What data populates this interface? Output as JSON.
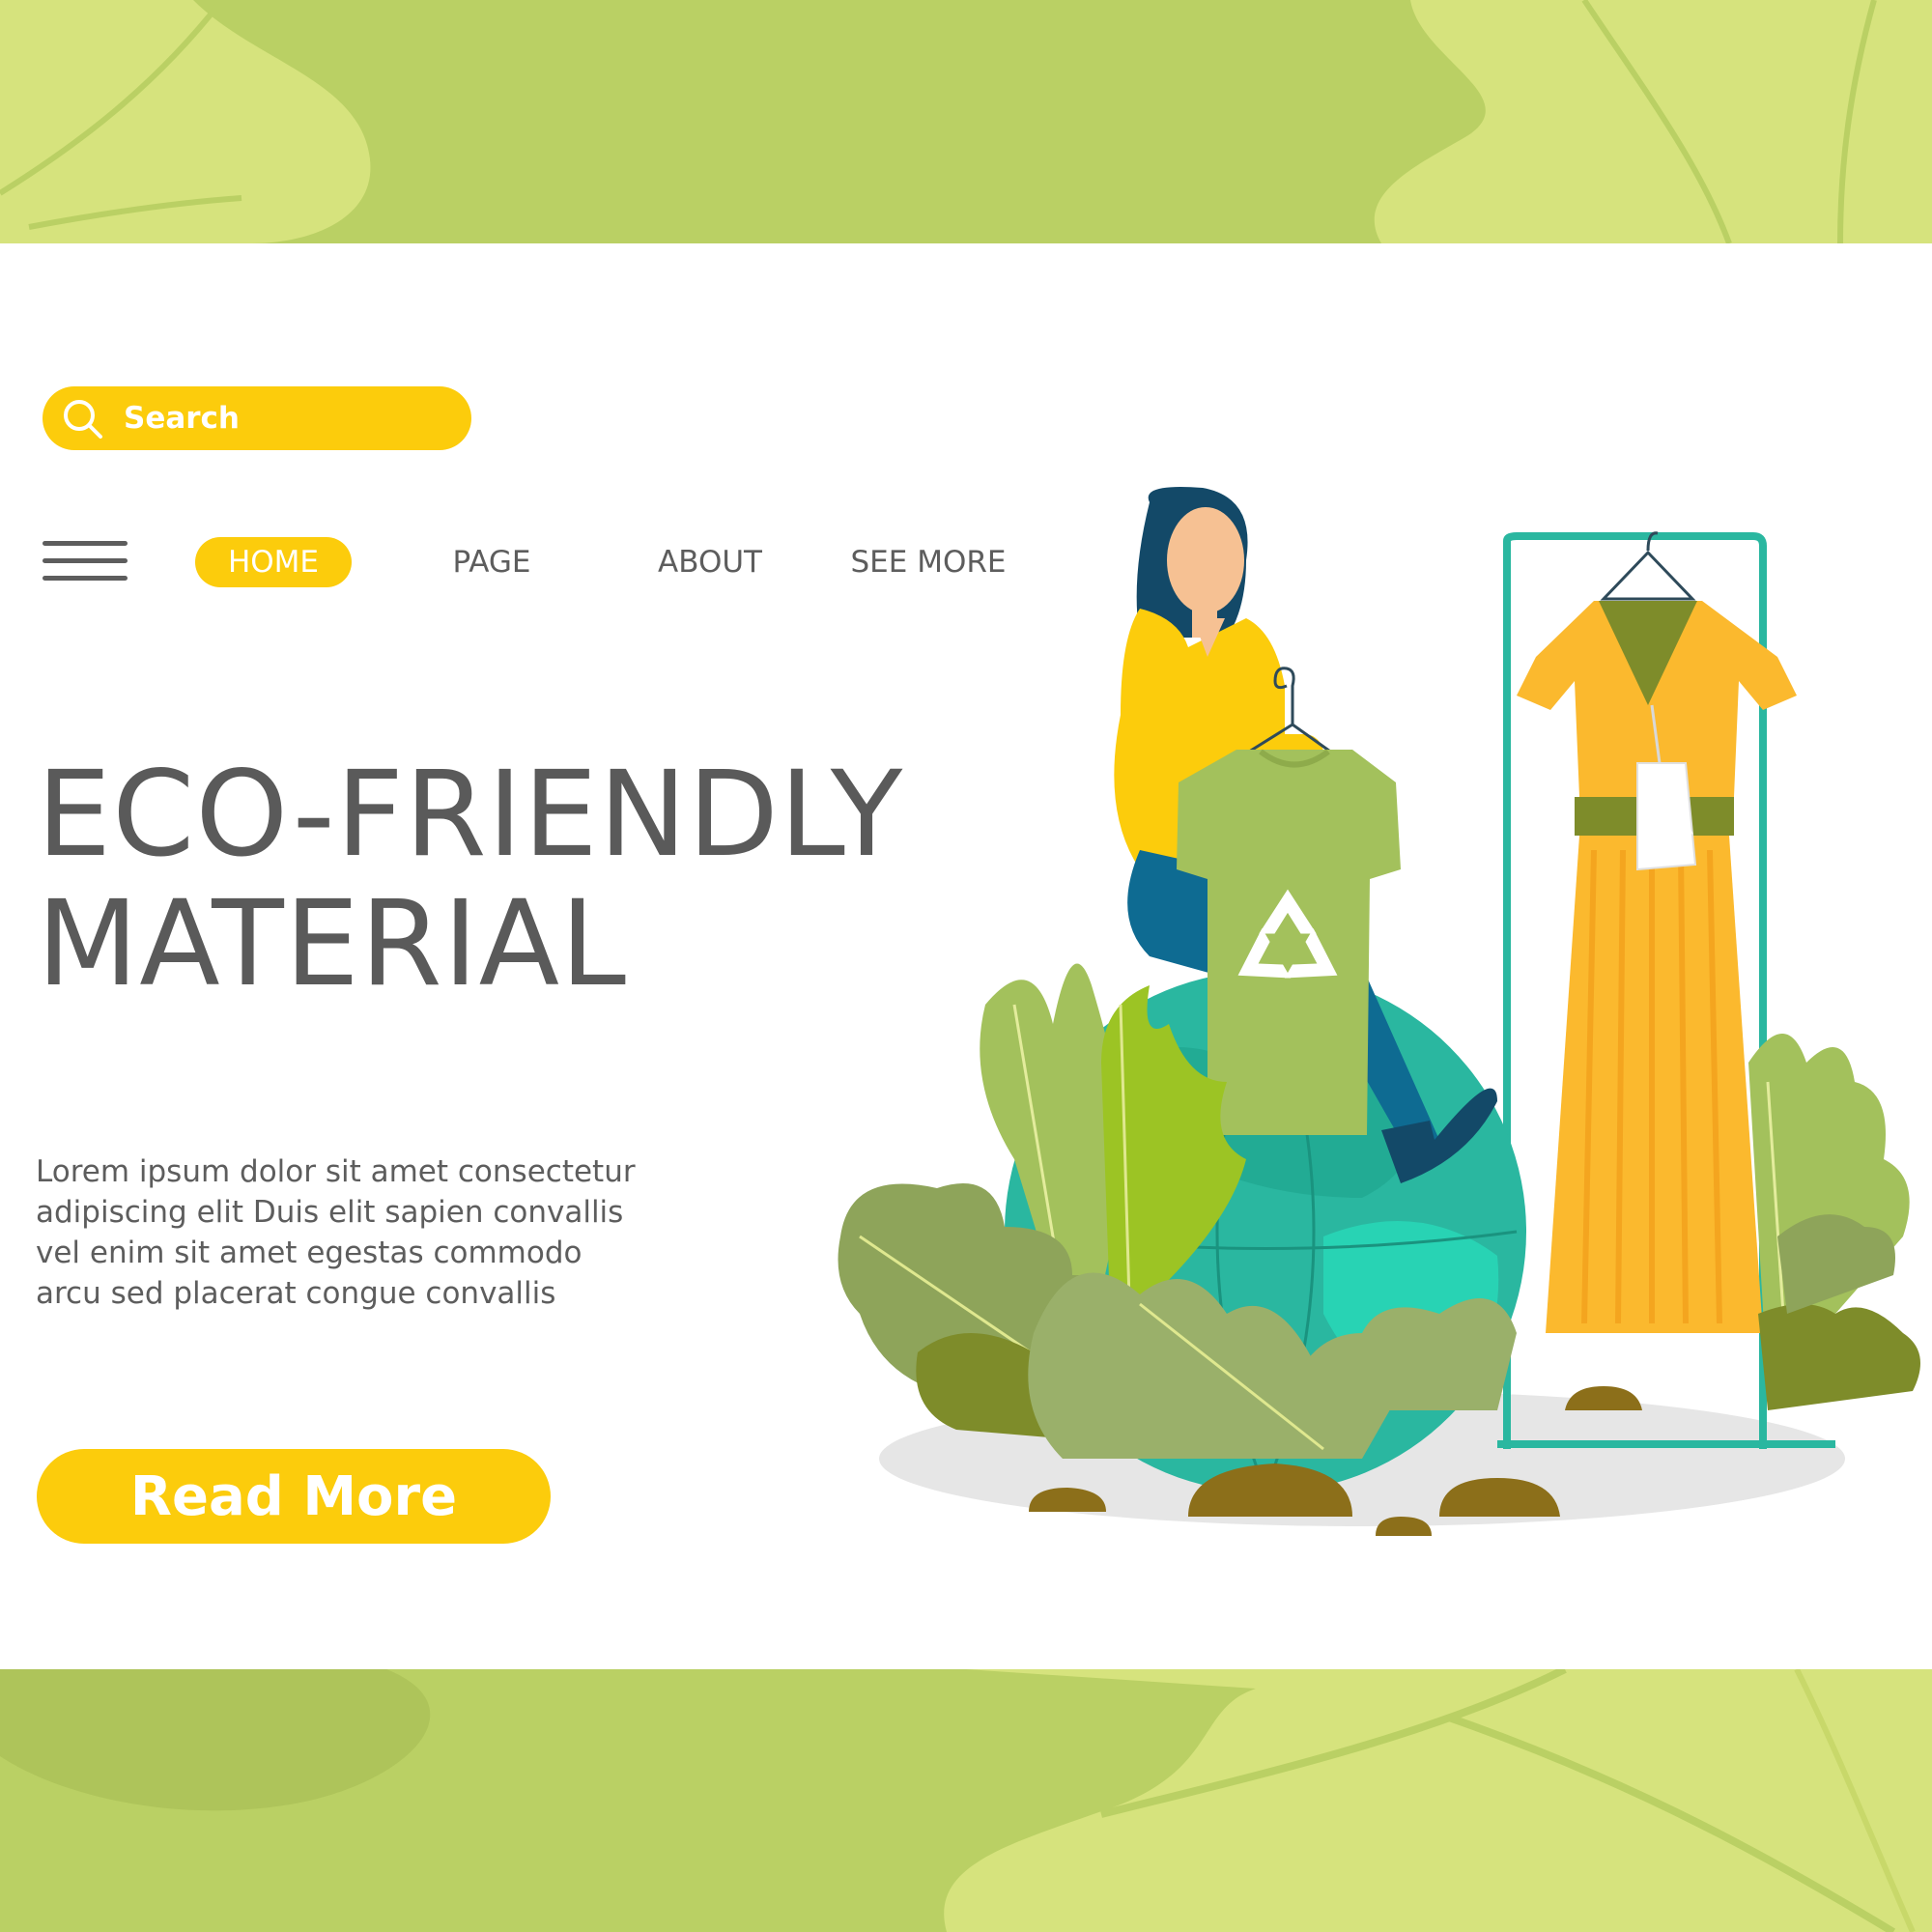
{
  "search": {
    "placeholder": "Search"
  },
  "nav": {
    "items": [
      {
        "label": "HOME",
        "active": true
      },
      {
        "label": "PAGE",
        "active": false
      },
      {
        "label": "ABOUT",
        "active": false
      },
      {
        "label": "SEE MORE",
        "active": false
      }
    ]
  },
  "hero": {
    "title_lines": [
      "ECO-FRIENDLY",
      "MATERIAL"
    ],
    "body_lines": [
      "Lorem ipsum dolor sit amet consectetur",
      "adipiscing elit Duis  elit  sapien convallis",
      "vel enim sit amet egestas commodo",
      "arcu sed placerat congue convallis"
    ],
    "cta_label": "Read More"
  },
  "colors": {
    "accent_yellow": "#fccc0c",
    "text_gray": "#5a5a5a",
    "band_green": "#bad064",
    "band_light_green": "#d6e37d",
    "teal": "#2ab7a0"
  },
  "icons": [
    "search-icon",
    "hamburger-menu-icon",
    "recycle-icon"
  ]
}
